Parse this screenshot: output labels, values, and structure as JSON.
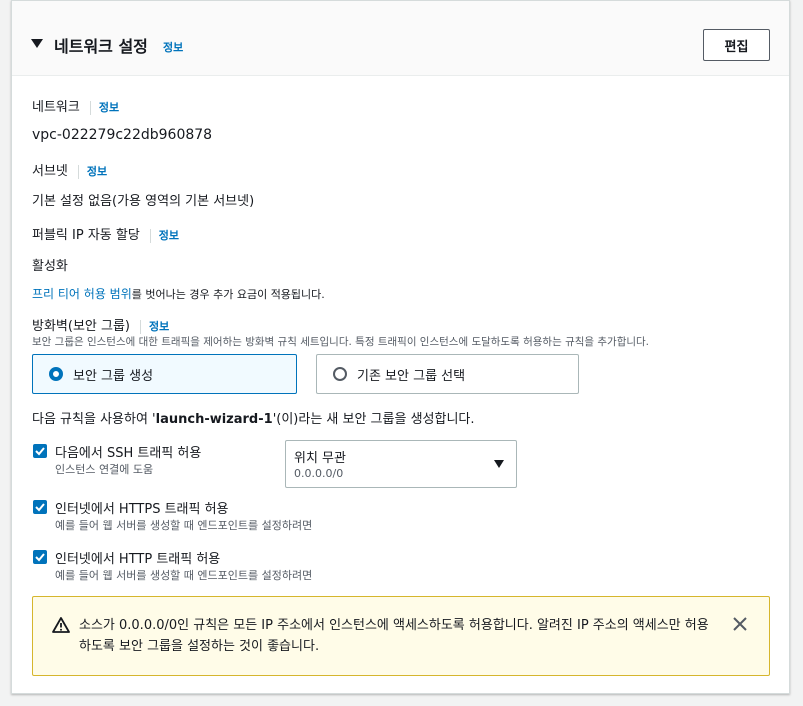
{
  "header": {
    "title": "네트워크 설정",
    "info": "정보",
    "edit_label": "편집"
  },
  "network": {
    "label": "네트워크",
    "info": "정보",
    "value": "vpc-022279c22db960878"
  },
  "subnet": {
    "label": "서브넷",
    "info": "정보",
    "value": "기본 설정 없음(가용 영역의 기본 서브넷)"
  },
  "public_ip": {
    "label": "퍼블릭 IP 자동 할당",
    "info": "정보",
    "value": "활성화"
  },
  "free_tier": {
    "link": "프리 티어 허용 범위",
    "text": "를 벗어나는 경우 추가 요금이 적용됩니다."
  },
  "firewall": {
    "label": "방화벽(보안 그룹)",
    "info": "정보",
    "description": "보안 그룹은 인스턴스에 대한 트래픽을 제어하는 방화벽 규칙 세트입니다. 특정 트래픽이 인스턴스에 도달하도록 허용하는 규칙을 추가합니다.",
    "options": [
      "보안 그룹 생성",
      "기존 보안 그룹 선택"
    ],
    "selected": "보안 그룹 생성"
  },
  "rules_intro": {
    "prefix": "다음 규칙을 사용하여 '",
    "name": "launch-wizard-1",
    "suffix": "'(이)라는 새 보안 그룹을 생성합니다."
  },
  "rules": [
    {
      "label": "다음에서 SSH 트래픽 허용",
      "hint": "인스턴스 연결에 도움",
      "checked": true
    },
    {
      "label": "인터넷에서 HTTPS 트래픽 허용",
      "hint": "예를 들어 웹 서버를 생성할 때 엔드포인트를 설정하려면",
      "checked": true
    },
    {
      "label": "인터넷에서 HTTP 트래픽 허용",
      "hint": "예를 들어 웹 서버를 생성할 때 엔드포인트를 설정하려면",
      "checked": true
    }
  ],
  "ssh_source": {
    "value": "위치 무관",
    "sub": "0.0.0.0/0"
  },
  "alert": {
    "text": "소스가 0.0.0.0/0인 규칙은 모든 IP 주소에서 인스턴스에 액세스하도록 허용합니다. 알려진 IP 주소의 액세스만 허용하도록 보안 그룹을 설정하는 것이 좋습니다."
  },
  "colors": {
    "accent": "#0073bb",
    "warning_border": "#d6b62d",
    "warning_bg": "#fffce8"
  },
  "icons": {
    "caret": "caret-down-icon",
    "warning": "warning-icon",
    "close": "close-icon",
    "check": "check-icon"
  }
}
